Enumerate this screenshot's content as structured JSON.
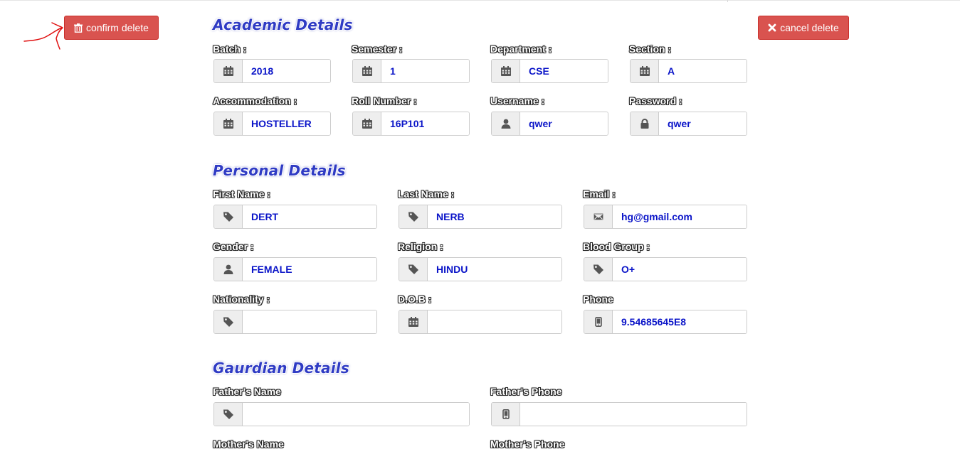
{
  "actions": {
    "confirm_label": "confirm delete",
    "cancel_label": "cancel delete",
    "button_color": "#d9534f",
    "confirm_icon": "trash-icon",
    "cancel_icon": "close-icon"
  },
  "academic": {
    "title": "Academic Details",
    "fields": [
      {
        "label": "Batch :",
        "value": "2018",
        "icon": "calendar-icon"
      },
      {
        "label": "Semester :",
        "value": "1",
        "icon": "calendar-icon"
      },
      {
        "label": "Department :",
        "value": "CSE",
        "icon": "calendar-icon"
      },
      {
        "label": "Section :",
        "value": "A",
        "icon": "calendar-icon"
      },
      {
        "label": "Accommodation :",
        "value": "HOSTELLER",
        "icon": "calendar-icon"
      },
      {
        "label": "Roll Number :",
        "value": "16P101",
        "icon": "calendar-icon"
      },
      {
        "label": "Username :",
        "value": "qwer",
        "icon": "user-icon"
      },
      {
        "label": "Password :",
        "value": "qwer",
        "icon": "lock-icon"
      }
    ]
  },
  "personal": {
    "title": "Personal Details",
    "fields": [
      {
        "label": "First Name :",
        "value": "DERT",
        "icon": "tag-icon"
      },
      {
        "label": "Last Name :",
        "value": "NERB",
        "icon": "tag-icon"
      },
      {
        "label": "Email :",
        "value": "hg@gmail.com",
        "icon": "envelope-icon"
      },
      {
        "label": "Gender :",
        "value": "FEMALE",
        "icon": "user-icon"
      },
      {
        "label": "Religion :",
        "value": "HINDU",
        "icon": "tag-icon"
      },
      {
        "label": "Blood Group :",
        "value": "O+",
        "icon": "tag-icon"
      },
      {
        "label": "Nationality :",
        "value": "",
        "icon": "tag-icon"
      },
      {
        "label": "D.O.B :",
        "value": "",
        "icon": "calendar-icon"
      },
      {
        "label": "Phone",
        "value": "9.54685645E8",
        "icon": "phone-icon"
      }
    ]
  },
  "guardian": {
    "title": "Gaurdian Details",
    "fields": [
      {
        "label": "Father's Name",
        "value": "",
        "icon": "tag-icon"
      },
      {
        "label": "Father's Phone",
        "value": "",
        "icon": "phone-icon"
      },
      {
        "label": "Mother's Name"
      },
      {
        "label": "Mother's Phone"
      }
    ]
  },
  "annotation": {
    "color": "#e01010",
    "icon": "arrow-annotation-icon"
  }
}
